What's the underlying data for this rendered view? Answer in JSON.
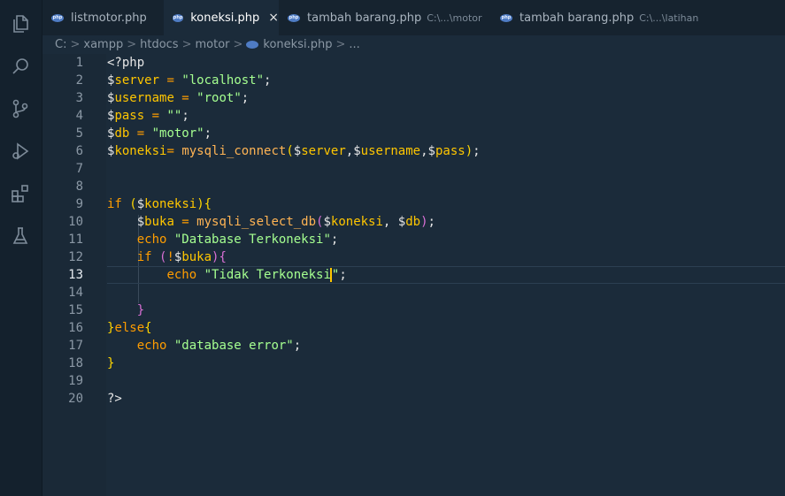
{
  "activity_bar": {
    "icons": [
      "explorer-icon",
      "search-icon",
      "source-control-icon",
      "run-debug-icon",
      "extensions-icon",
      "testing-icon"
    ]
  },
  "tabs": [
    {
      "label": "listmotor.php",
      "path": "",
      "active": false
    },
    {
      "label": "koneksi.php",
      "path": "",
      "active": true,
      "close": "×"
    },
    {
      "label": "tambah barang.php",
      "path": "C:\\...\\motor",
      "active": false
    },
    {
      "label": "tambah barang.php",
      "path": "C:\\...\\latihan",
      "active": false
    }
  ],
  "breadcrumb": {
    "items": [
      "C:",
      "xampp",
      "htdocs",
      "motor",
      "koneksi.php",
      "..."
    ],
    "separator": ">"
  },
  "editor": {
    "current_line": 13,
    "lines": [
      {
        "n": "1",
        "tokens": [
          [
            "t-tag",
            "<?php"
          ]
        ]
      },
      {
        "n": "2",
        "tokens": [
          [
            "t-dollar",
            "$"
          ],
          [
            "t-var",
            "server"
          ],
          [
            "t-op",
            " = "
          ],
          [
            "t-str",
            "\"localhost\""
          ],
          [
            "t-punc",
            ";"
          ]
        ]
      },
      {
        "n": "3",
        "tokens": [
          [
            "t-dollar",
            "$"
          ],
          [
            "t-var",
            "username"
          ],
          [
            "t-op",
            " = "
          ],
          [
            "t-str",
            "\"root\""
          ],
          [
            "t-punc",
            ";"
          ]
        ]
      },
      {
        "n": "4",
        "tokens": [
          [
            "t-dollar",
            "$"
          ],
          [
            "t-var",
            "pass"
          ],
          [
            "t-op",
            " = "
          ],
          [
            "t-str",
            "\"\""
          ],
          [
            "t-punc",
            ";"
          ]
        ]
      },
      {
        "n": "5",
        "tokens": [
          [
            "t-dollar",
            "$"
          ],
          [
            "t-var",
            "db"
          ],
          [
            "t-op",
            " = "
          ],
          [
            "t-str",
            "\"motor\""
          ],
          [
            "t-punc",
            ";"
          ]
        ]
      },
      {
        "n": "6",
        "tokens": [
          [
            "t-dollar",
            "$"
          ],
          [
            "t-var",
            "koneksi"
          ],
          [
            "t-op",
            "= "
          ],
          [
            "t-fn",
            "mysqli_connect"
          ],
          [
            "t-par1",
            "("
          ],
          [
            "t-dollar",
            "$"
          ],
          [
            "t-var",
            "server"
          ],
          [
            "t-punc",
            ","
          ],
          [
            "t-dollar",
            "$"
          ],
          [
            "t-var",
            "username"
          ],
          [
            "t-punc",
            ","
          ],
          [
            "t-dollar",
            "$"
          ],
          [
            "t-var",
            "pass"
          ],
          [
            "t-par1",
            ")"
          ],
          [
            "t-punc",
            ";"
          ]
        ]
      },
      {
        "n": "7",
        "tokens": []
      },
      {
        "n": "8",
        "tokens": []
      },
      {
        "n": "9",
        "tokens": [
          [
            "t-kw",
            "if "
          ],
          [
            "t-par1",
            "("
          ],
          [
            "t-dollar",
            "$"
          ],
          [
            "t-var",
            "koneksi"
          ],
          [
            "t-par1",
            ")"
          ],
          [
            "t-par1",
            "{"
          ]
        ]
      },
      {
        "n": "10",
        "tokens": [
          [
            "t-punc",
            "    "
          ],
          [
            "t-dollar",
            "$"
          ],
          [
            "t-var",
            "buka"
          ],
          [
            "t-op",
            " = "
          ],
          [
            "t-fn",
            "mysqli_select_db"
          ],
          [
            "t-par2",
            "("
          ],
          [
            "t-dollar",
            "$"
          ],
          [
            "t-var",
            "koneksi"
          ],
          [
            "t-punc",
            ", "
          ],
          [
            "t-dollar",
            "$"
          ],
          [
            "t-var",
            "db"
          ],
          [
            "t-par2",
            ")"
          ],
          [
            "t-punc",
            ";"
          ]
        ]
      },
      {
        "n": "11",
        "tokens": [
          [
            "t-punc",
            "    "
          ],
          [
            "t-kw",
            "echo "
          ],
          [
            "t-str",
            "\"Database Terkoneksi\""
          ],
          [
            "t-punc",
            ";"
          ]
        ]
      },
      {
        "n": "12",
        "tokens": [
          [
            "t-punc",
            "    "
          ],
          [
            "t-kw",
            "if "
          ],
          [
            "t-par2",
            "("
          ],
          [
            "t-op",
            "!"
          ],
          [
            "t-dollar",
            "$"
          ],
          [
            "t-var",
            "buka"
          ],
          [
            "t-par2",
            ")"
          ],
          [
            "t-par2",
            "{"
          ]
        ]
      },
      {
        "n": "13",
        "tokens": [
          [
            "t-punc",
            "        "
          ],
          [
            "t-kw",
            "echo "
          ],
          [
            "t-str",
            "\"Tidak Terkoneksi"
          ],
          [
            "cursor",
            ""
          ],
          [
            "t-str",
            "\""
          ],
          [
            "t-punc",
            ";"
          ]
        ]
      },
      {
        "n": "14",
        "tokens": []
      },
      {
        "n": "15",
        "tokens": [
          [
            "t-punc",
            "    "
          ],
          [
            "t-par2",
            "}"
          ]
        ]
      },
      {
        "n": "16",
        "tokens": [
          [
            "t-par1",
            "}"
          ],
          [
            "t-kw",
            "else"
          ],
          [
            "t-par1",
            "{"
          ]
        ]
      },
      {
        "n": "17",
        "tokens": [
          [
            "t-punc",
            "    "
          ],
          [
            "t-kw",
            "echo "
          ],
          [
            "t-str",
            "\"database error\""
          ],
          [
            "t-punc",
            ";"
          ]
        ]
      },
      {
        "n": "18",
        "tokens": [
          [
            "t-par1",
            "}"
          ]
        ]
      },
      {
        "n": "19",
        "tokens": []
      },
      {
        "n": "20",
        "tokens": [
          [
            "t-tag",
            "?>"
          ]
        ]
      }
    ]
  }
}
